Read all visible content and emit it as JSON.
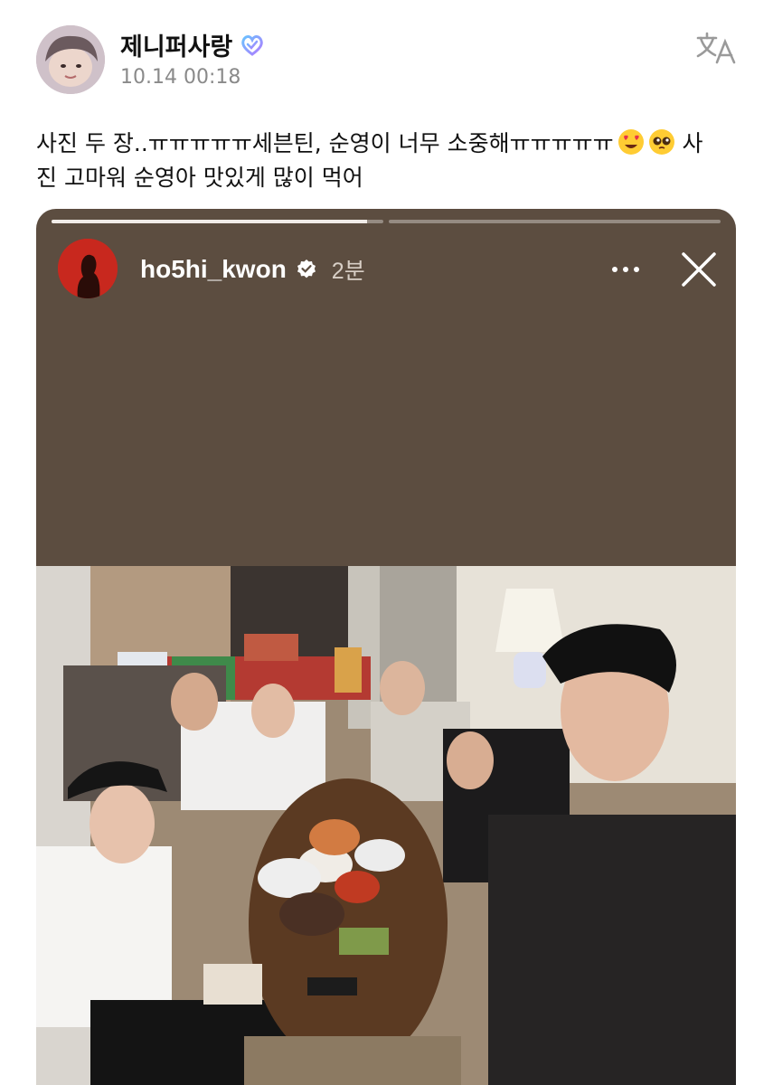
{
  "post": {
    "username": "제니퍼사랑",
    "timestamp": "10.14 00:18",
    "text": "사진 두 장..ㅠㅠㅠㅠㅠ세븐틴, 순영이 너무 소중해ㅠㅠㅠㅠㅠ",
    "text_after_emoji": " 사진 고마워 순영아 맛있게 많이 먹어",
    "icons": {
      "verified_badge": "heart-badge-icon",
      "translate": "translate-icon",
      "emoji_1": "heart-eyes-emoji-icon",
      "emoji_2": "pleading-face-emoji-icon"
    }
  },
  "story": {
    "username": "ho5hi_kwon",
    "time_ago": "2분",
    "progress": [
      0.95,
      0.0
    ],
    "icons": {
      "verified": "verified-check-icon",
      "more": "more-options-icon",
      "close": "close-icon"
    },
    "background_color": "#5c4d40"
  },
  "colors": {
    "badge_gradient_start": "#6ac2ff",
    "badge_gradient_end": "#b07bff",
    "timestamp": "#8a8a8a"
  }
}
